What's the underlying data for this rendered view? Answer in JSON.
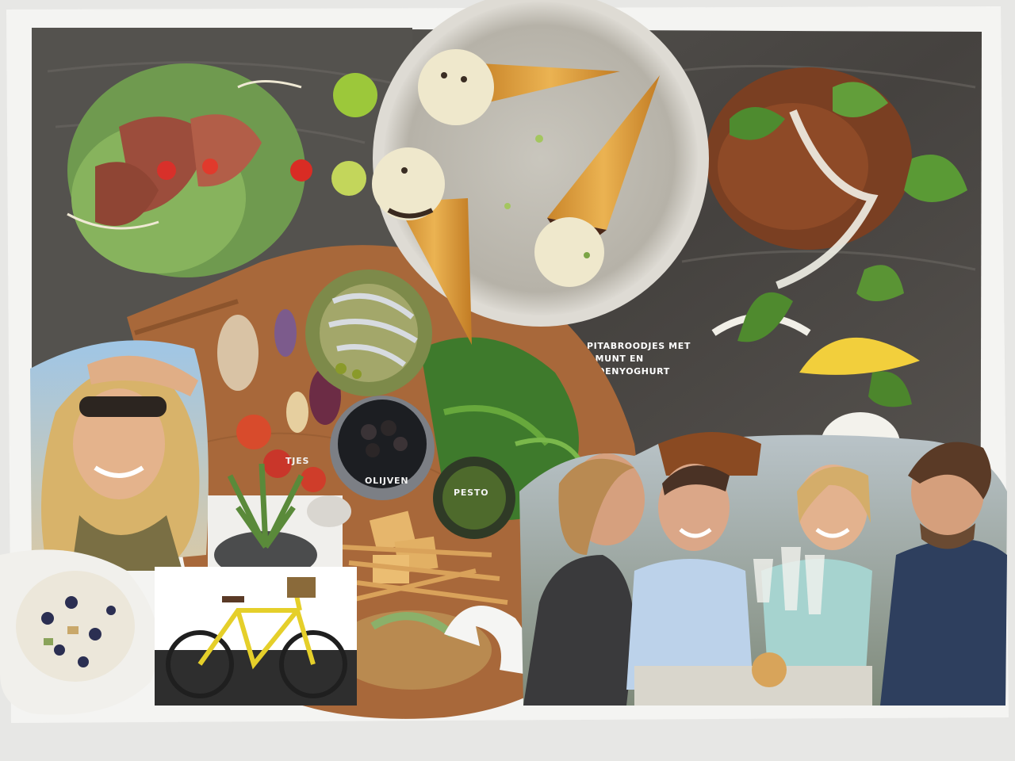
{
  "collage": {
    "caption": {
      "line1": "PITABROODJES MET",
      "line2": "A, MUNT EN",
      "line3": "TROENYOGHURT"
    },
    "labels": {
      "olives": "OLIJVEN",
      "pesto": "PESTO",
      "partial": "TJES"
    }
  },
  "colors": {
    "paper": "#f4f4f2",
    "tray": "#4d4b49",
    "board": "#a8683a",
    "cone": "#e0a33c",
    "bike": "#e5cf2a",
    "lemon": "#f2cf3c"
  }
}
